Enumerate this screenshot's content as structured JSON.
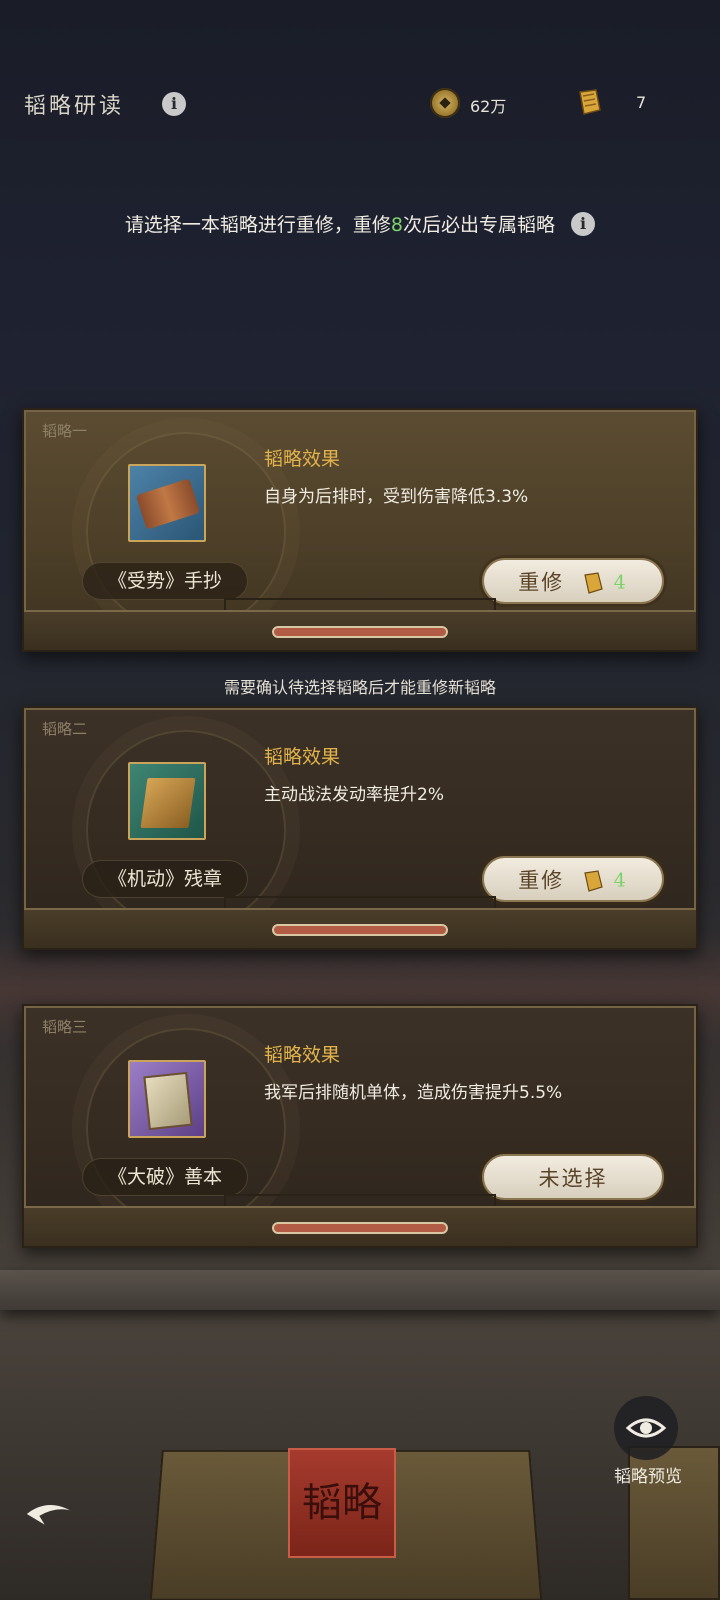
{
  "header": {
    "title": "韬略研读",
    "coins": "62万",
    "scrolls": "7"
  },
  "notice": {
    "prefix": "请选择一本韬略进行重修，重修",
    "count": "8",
    "suffix": "次后必出专属韬略"
  },
  "hint": "需要确认待选择韬略后才能重修新韬略",
  "cards": [
    {
      "tag": "韬略一",
      "book_name": "《受势》手抄",
      "effect_title": "韬略效果",
      "effect_text": "自身为后排时，受到伤害降低3.3%",
      "button_label": "重修",
      "button_cost": "4"
    },
    {
      "tag": "韬略二",
      "book_name": "《机动》残章",
      "effect_title": "韬略效果",
      "effect_text": "主动战法发动率提升2%",
      "button_label": "重修",
      "button_cost": "4"
    },
    {
      "tag": "韬略三",
      "book_name": "《大破》善本",
      "effect_title": "韬略效果",
      "effect_text": "我军后排随机单体，造成伤害提升5.5%",
      "button_label": "未选择"
    }
  ],
  "bottom": {
    "preview_label": "韬略预览",
    "book_seal": "韬略"
  },
  "icons": {
    "info": "info-icon",
    "coin": "coin-icon",
    "scroll": "scroll-icon",
    "eye": "eye-icon",
    "back": "back-arrow-icon"
  },
  "colors": {
    "accent_gold": "#e2b34c",
    "highlight_green": "#7cd36a"
  }
}
